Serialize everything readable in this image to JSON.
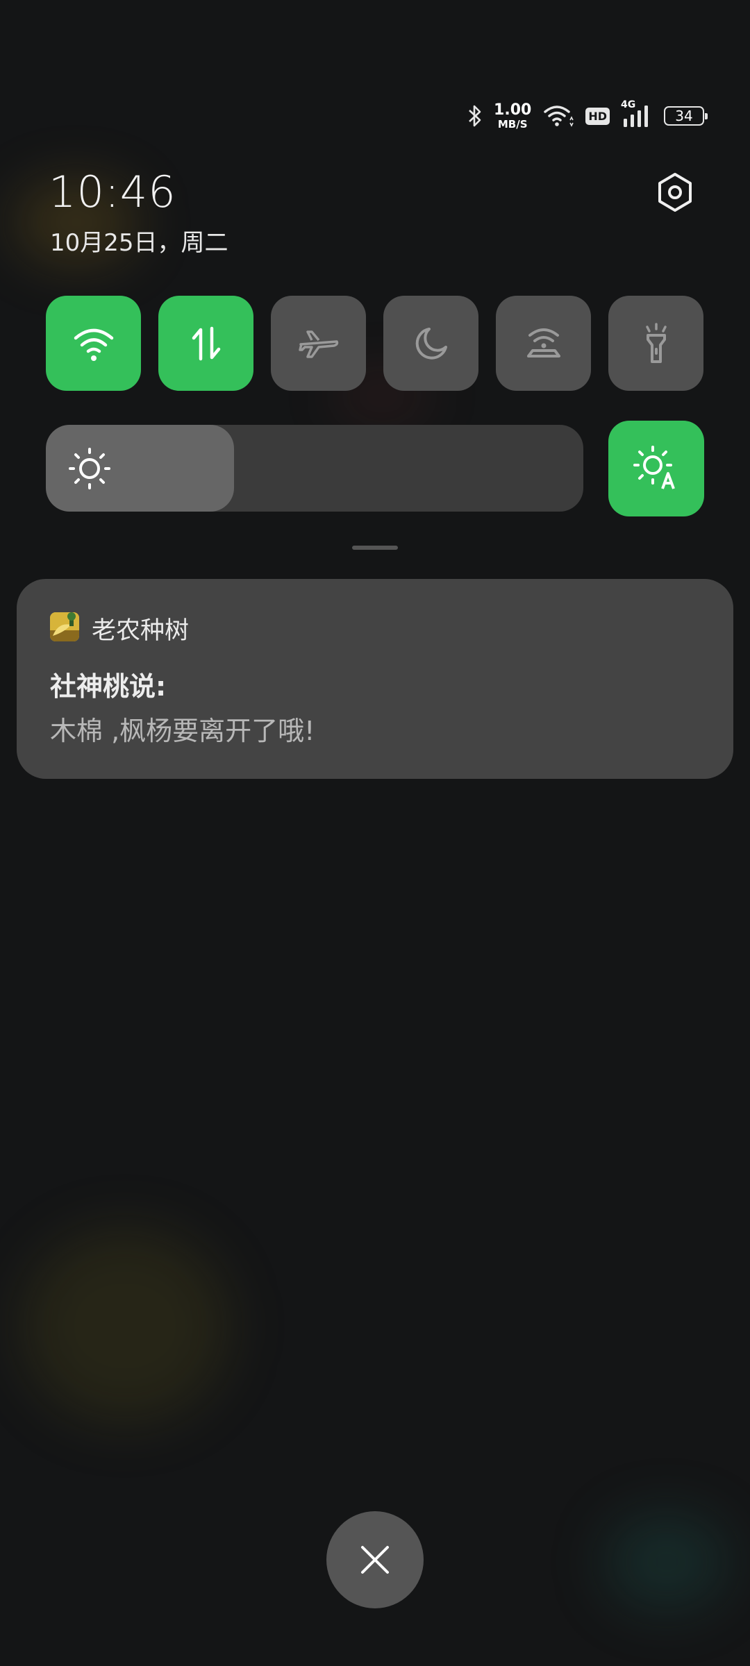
{
  "status_bar": {
    "network_speed_value": "1.00",
    "network_speed_unit": "MB/S",
    "hd_label": "HD",
    "network_type": "4G",
    "battery_level": "34",
    "icons": [
      "bluetooth-icon",
      "wifi-icon",
      "hd-icon",
      "signal-icon",
      "battery-icon"
    ]
  },
  "header": {
    "time": "10:46",
    "date": "10月25日，周二",
    "settings_icon": "settings-icon"
  },
  "quick_settings": {
    "tiles": [
      {
        "icon": "wifi-icon",
        "active": true
      },
      {
        "icon": "mobile-data-icon",
        "active": true
      },
      {
        "icon": "airplane-icon",
        "active": false
      },
      {
        "icon": "moon-icon",
        "active": false
      },
      {
        "icon": "hotspot-icon",
        "active": false
      },
      {
        "icon": "flashlight-icon",
        "active": false
      }
    ],
    "brightness_level": 0.35,
    "auto_brightness_active": true
  },
  "notification": {
    "app_name": "老农种树",
    "title": "社神桃说:",
    "body": "木棉 ,枫杨要离开了哦!"
  },
  "colors": {
    "accent": "#34c05a",
    "background": "#141516",
    "tile_inactive": "#505050",
    "card": "#444444"
  }
}
